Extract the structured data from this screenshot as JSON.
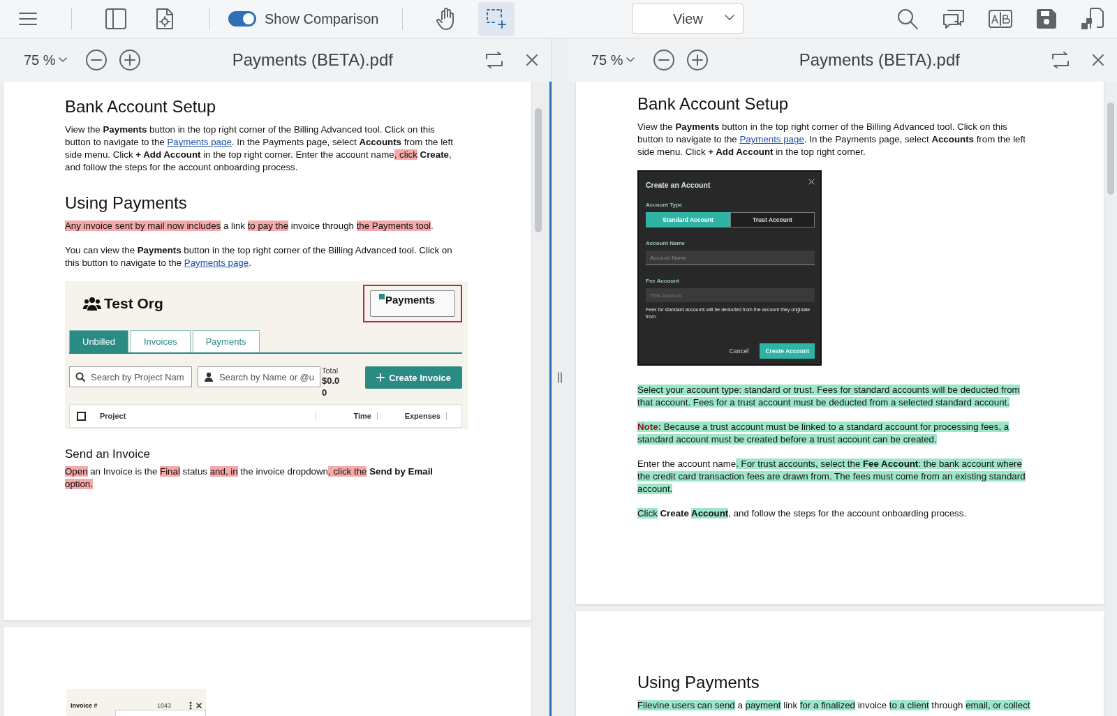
{
  "toolbar": {
    "comparison_toggle": {
      "label": "Show Comparison",
      "on": true
    },
    "tools": [
      {
        "kind": "hand",
        "selected": false
      },
      {
        "kind": "select",
        "selected": true
      }
    ],
    "view_select": {
      "value": "View"
    }
  },
  "panes": [
    {
      "kind": "original",
      "active": true,
      "zoom": "75 %",
      "title": "Payments (BETA).pdf",
      "pages": [
        {
          "blocks": [
            {
              "kind": "heading",
              "text": "Bank Account Setup"
            },
            {
              "kind": "paragraph",
              "runs": [
                {
                  "t": "View the "
                },
                {
                  "t": "Payments",
                  "bold": true
                },
                {
                  "t": " button in the top right corner of the Billing Advanced tool. Click on this button to navigate to the "
                },
                {
                  "t": "Payments page",
                  "kind": "link"
                },
                {
                  "t": ". In the Payments page, select "
                },
                {
                  "t": "Accounts",
                  "bold": true
                },
                {
                  "t": " from the left side menu. Click "
                },
                {
                  "t": "+ Add Account",
                  "bold": true
                },
                {
                  "t": " in the top right corner. Enter the account name"
                },
                {
                  "t": ", click",
                  "highlight": true
                },
                {
                  "t": " Create",
                  "bold": true
                },
                {
                  "t": ", and follow the steps for the account onboarding process."
                }
              ]
            },
            {
              "kind": "heading",
              "text": "Using Payments"
            },
            {
              "kind": "paragraph",
              "runs": [
                {
                  "t": "Any invoice sent by mail now includes",
                  "highlight": true
                },
                {
                  "t": " a link "
                },
                {
                  "t": "to pay the",
                  "highlight": true
                },
                {
                  "t": " invoice through "
                },
                {
                  "t": "the Payments tool",
                  "highlight": true
                },
                {
                  "t": "."
                }
              ]
            },
            {
              "kind": "paragraph",
              "runs": [
                {
                  "t": "You can view the "
                },
                {
                  "t": "Payments",
                  "bold": true
                },
                {
                  "t": " button in the top right corner of the Billing Advanced tool. Click on this button to navigate to the "
                },
                {
                  "t": "Payments page",
                  "kind": "link"
                },
                {
                  "t": "."
                }
              ]
            },
            {
              "kind": "app_screenshot",
              "org_name": "Test Org",
              "payments_button": "Payments",
              "tabs": [
                {
                  "label": "Unbilled",
                  "selected": true
                },
                {
                  "label": "Invoices",
                  "selected": false
                },
                {
                  "label": "Payments",
                  "selected": false
                }
              ],
              "search_fields": [
                {
                  "kind": "search",
                  "placeholder": "Search by Project Nam"
                },
                {
                  "kind": "person",
                  "placeholder": "Search by Name or @u"
                }
              ],
              "total_label": "Total",
              "total_value": "$0.00",
              "create_button": "Create Invoice",
              "select_all": {
                "checked": false
              },
              "columns": [
                "Project",
                "Time",
                "Expenses"
              ]
            },
            {
              "kind": "subheading",
              "text": "Send an Invoice"
            },
            {
              "kind": "paragraph",
              "runs": [
                {
                  "t": "Open",
                  "highlight": true
                },
                {
                  "t": " an Invoice is the "
                },
                {
                  "t": "Final",
                  "highlight": true
                },
                {
                  "t": " status "
                },
                {
                  "t": "and, in",
                  "highlight": true
                },
                {
                  "t": " the invoice dropdown"
                },
                {
                  "t": ", click the",
                  "highlight": true
                },
                {
                  "t": " Send by Email ",
                  "bold": true
                },
                {
                  "t": "option.",
                  "highlight": true
                }
              ]
            }
          ]
        },
        {
          "blocks": [
            {
              "kind": "snippet",
              "label": "Invoice #",
              "value": "1043"
            }
          ]
        }
      ]
    },
    {
      "kind": "revised",
      "active": false,
      "zoom": "75 %",
      "title": "Payments (BETA).pdf",
      "pages": [
        {
          "blocks": [
            {
              "kind": "heading",
              "text": "Bank Account Setup"
            },
            {
              "kind": "paragraph",
              "runs": [
                {
                  "t": "View the "
                },
                {
                  "t": "Payments",
                  "bold": true
                },
                {
                  "t": " button in the top right corner of the Billing Advanced tool. Click on this button to navigate to the "
                },
                {
                  "t": "Payments page",
                  "kind": "link"
                },
                {
                  "t": ". In the Payments page, select "
                },
                {
                  "t": "Accounts",
                  "bold": true
                },
                {
                  "t": " from the left side menu. Click "
                },
                {
                  "t": "+ Add Account",
                  "bold": true
                },
                {
                  "t": " in the top right corner."
                }
              ]
            },
            {
              "kind": "dialog",
              "title": "Create an Account",
              "type_label": "Account Type",
              "type_options": [
                {
                  "label": "Standard Account",
                  "selected": true
                },
                {
                  "label": "Trust Account",
                  "selected": false
                }
              ],
              "name_label": "Account Name",
              "name_placeholder": "Account Name",
              "fee_label": "Fee Account",
              "fee_placeholder": "This Account",
              "fee_disabled": true,
              "help": "Fees for standard accounts will be deducted from the account they originate from.",
              "buttons": [
                {
                  "kind": "secondary",
                  "label": "Cancel"
                },
                {
                  "kind": "primary",
                  "label": "Create Account"
                }
              ]
            },
            {
              "kind": "paragraph",
              "runs": [
                {
                  "t": "Select your account type: standard or trust. Fees for standard accounts will be deducted from that account. Fees for a trust account must be deducted from a selected standard account.",
                  "highlight": true
                }
              ]
            },
            {
              "kind": "paragraph",
              "runs": [
                {
                  "t": "Note:",
                  "bold": true,
                  "kind": "note",
                  "highlight": true
                },
                {
                  "t": " Because a trust account must be linked to a standard account for processing fees, a standard account must be created before a trust account can be created.",
                  "highlight": true
                }
              ]
            },
            {
              "kind": "paragraph",
              "runs": [
                {
                  "t": "Enter the account name"
                },
                {
                  "t": ". For trust accounts, select the ",
                  "highlight": true
                },
                {
                  "t": "Fee Account",
                  "bold": true,
                  "highlight": true
                },
                {
                  "t": ": the bank account where the credit card transaction fees are drawn from. The fees must come from an existing standard account.",
                  "highlight": true
                }
              ]
            },
            {
              "kind": "paragraph",
              "runs": [
                {
                  "t": "Click",
                  "highlight": true
                },
                {
                  "t": " Create ",
                  "bold": true
                },
                {
                  "t": "Account",
                  "bold": true,
                  "highlight": true
                },
                {
                  "t": ", and follow the steps for the account onboarding process."
                }
              ]
            }
          ]
        },
        {
          "blocks": [
            {
              "kind": "heading",
              "text": "Using Payments"
            },
            {
              "kind": "paragraph",
              "runs": [
                {
                  "t": "Filevine users can send",
                  "highlight": true
                },
                {
                  "t": " a "
                },
                {
                  "t": "payment",
                  "highlight": true
                },
                {
                  "t": " link "
                },
                {
                  "t": "for a finalized",
                  "highlight": true
                },
                {
                  "t": " invoice "
                },
                {
                  "t": "to a client",
                  "highlight": true
                },
                {
                  "t": " through "
                },
                {
                  "t": "email, or collect",
                  "highlight": true
                }
              ]
            }
          ]
        }
      ]
    }
  ]
}
